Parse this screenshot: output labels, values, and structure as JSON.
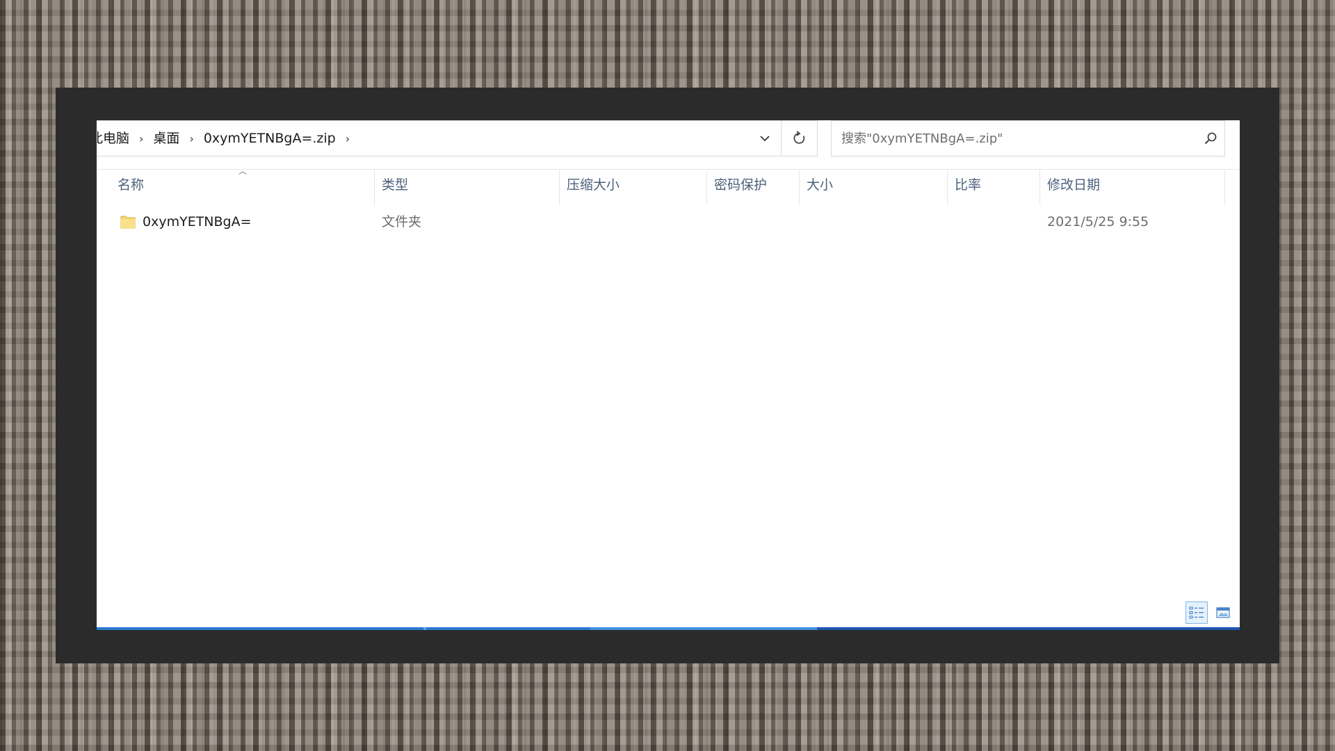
{
  "address": {
    "breadcrumbs": [
      "此电脑",
      "桌面",
      "0xymYETNBgA=.zip"
    ]
  },
  "search": {
    "placeholder": "搜索\"0xymYETNBgA=.zip\""
  },
  "columns": [
    "名称",
    "类型",
    "压缩大小",
    "密码保护",
    "大小",
    "比率",
    "修改日期"
  ],
  "files": [
    {
      "name": "0xymYETNBgA=",
      "type": "文件夹",
      "compressed_size": "",
      "password_protected": "",
      "size": "",
      "ratio": "",
      "modified": "2021/5/25 9:55"
    }
  ],
  "colors": {
    "frame": "#2b2b2b",
    "header_text": "#4c607a",
    "accent": "#2a7bd1",
    "folder": "#f7d36b"
  },
  "icons": {
    "sort": "chevron-up-icon",
    "dropdown": "chevron-down-icon",
    "refresh": "refresh-icon",
    "search": "search-icon",
    "folder": "folder-icon",
    "details_view": "details-view-icon",
    "large_icons_view": "large-icons-view-icon"
  }
}
